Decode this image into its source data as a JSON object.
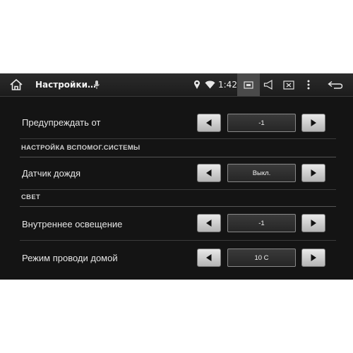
{
  "statusbar": {
    "app_title": "Настройки…",
    "time": "1:42"
  },
  "settings": {
    "row1": {
      "label": "Предупреждать от",
      "value": "-1"
    },
    "section1": {
      "title": "НАСТРОЙКА ВСПОМОГ.СИСТЕМЫ"
    },
    "row2": {
      "label": "Датчик дождя",
      "value": "Выкл."
    },
    "section2": {
      "title": "СВЕТ"
    },
    "row3": {
      "label": "Внутреннее освещение",
      "value": "-1"
    },
    "row4": {
      "label": "Режим проводи домой",
      "value": "10 С"
    }
  }
}
